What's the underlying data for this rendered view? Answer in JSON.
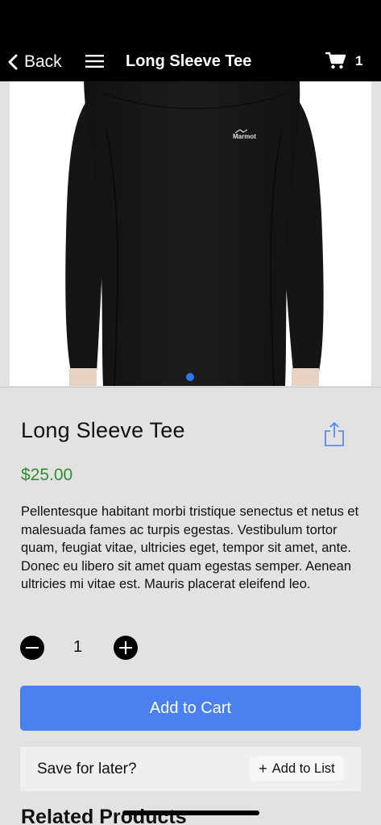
{
  "nav": {
    "back_label": "Back",
    "title": "Long Sleeve Tee",
    "cart_count": "1",
    "icons": {
      "back": "chevron-left-icon",
      "menu": "hamburger-menu-icon",
      "cart": "shopping-cart-icon"
    }
  },
  "gallery": {
    "image": "black-long-sleeve-tee-photo",
    "brand_print": "Marmot",
    "current_page": 1,
    "page_count": 1,
    "dot_color": "#2b78f2"
  },
  "product": {
    "title": "Long Sleeve Tee",
    "price": "$25.00",
    "price_color": "#2f8f2f",
    "description": "Pellentesque habitant morbi tristique senectus et netus et malesuada fames ac turpis egestas. Vestibulum tortor quam, feugiat vitae, ultricies eget, tempor sit amet, ante. Donec eu libero sit amet quam egestas semper. Aenean ultricies mi vitae est. Mauris placerat eleifend leo.",
    "share_icon": "share-icon"
  },
  "quantity": {
    "value": "1",
    "decrement_icon": "minus-circle-icon",
    "increment_icon": "plus-circle-icon"
  },
  "actions": {
    "add_to_cart_label": "Add to Cart",
    "add_to_cart_color": "#4a80ef",
    "save_for_later_label": "Save for later?",
    "add_to_list_label": "Add to List",
    "add_to_list_icon": "plus-icon"
  },
  "related": {
    "heading": "Related Products"
  }
}
